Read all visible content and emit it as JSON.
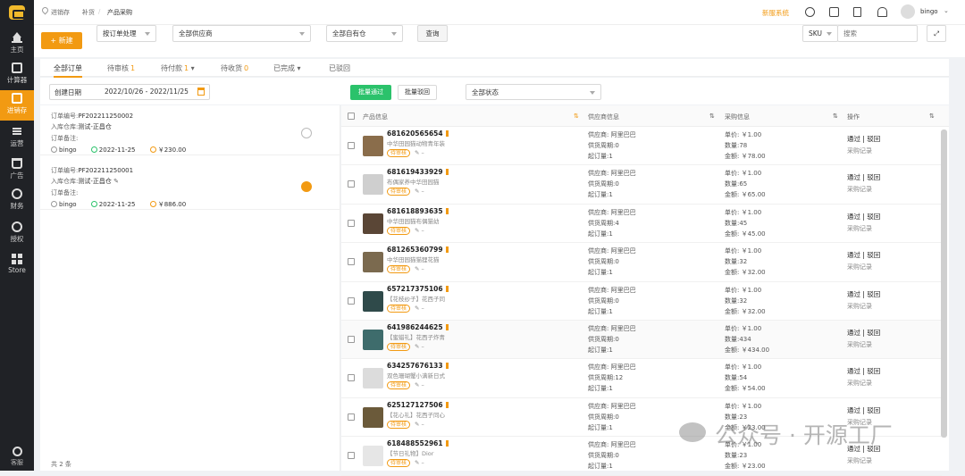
{
  "sidebar": {
    "items": [
      {
        "label": "主页",
        "icon": "home-icon"
      },
      {
        "label": "计算器",
        "icon": "calculator-icon"
      },
      {
        "label": "进销存",
        "icon": "inventory-icon"
      },
      {
        "label": "运营",
        "icon": "operations-icon"
      },
      {
        "label": "广告",
        "icon": "ads-icon"
      },
      {
        "label": "财务",
        "icon": "finance-icon"
      },
      {
        "label": "授权",
        "icon": "auth-icon"
      },
      {
        "label": "Store",
        "icon": "store-icon"
      }
    ],
    "help": "客服",
    "active_index": 2
  },
  "breadcrumb": [
    "进销存",
    "补货",
    "产品采购"
  ],
  "topbar": {
    "notice": "新服系统",
    "username": "bingo"
  },
  "toolbar": {
    "new_label": "+ 新建",
    "by_order": "按订单处理",
    "supplier": "全部供应商",
    "warehouse": "全部自有仓",
    "query": "查询",
    "sku_select": "SKU",
    "search_placeholder": "搜索"
  },
  "tabs": [
    {
      "label": "全部订单",
      "count": ""
    },
    {
      "label": "待审核",
      "count": "1"
    },
    {
      "label": "待付款",
      "count": "1"
    },
    {
      "label": "待收货",
      "count": "0"
    },
    {
      "label": "已完成",
      "count": ""
    },
    {
      "label": "已驳回",
      "count": ""
    }
  ],
  "filter": {
    "date_type": "创建日期",
    "date_range": "2022/10/26 - 2022/11/25",
    "batch_approve": "批量通过",
    "batch_reject": "批量驳回",
    "status": "全部状态"
  },
  "orders": [
    {
      "order_no_label": "订单编号:",
      "order_no": "PF202211250002",
      "warehouse_label": "入库仓库:",
      "warehouse": "测试-正昌仓",
      "note_label": "订单备注:",
      "user": "bingo",
      "date": "2022-11-25",
      "amount": "￥230.00"
    },
    {
      "order_no_label": "订单编号:",
      "order_no": "PF202211250001",
      "warehouse_label": "入库仓库:",
      "warehouse": "测试-正昌仓",
      "note_label": "订单备注:",
      "user": "bingo",
      "date": "2022-11-25",
      "amount": "￥886.00"
    }
  ],
  "total": "共 2 条",
  "table": {
    "headers": [
      "产品信息",
      "供应商信息",
      "采购信息",
      "操作"
    ],
    "rows": [
      {
        "id": "681620565654",
        "name": "中华田园猫动物青年装",
        "status": "待审核",
        "supplier": "供应商: 阿里巴巴",
        "lead": "供货周期:0",
        "moq": "起订量:1",
        "price": "单价: ￥1.00",
        "qty": "数量:78",
        "amount": "金额: ￥78.00"
      },
      {
        "id": "681619433929",
        "name": "布偶家养中华田园猫",
        "status": "待审核",
        "supplier": "供应商: 阿里巴巴",
        "lead": "供货周期:0",
        "moq": "起订量:1",
        "price": "单价: ￥1.00",
        "qty": "数量:65",
        "amount": "金额: ￥65.00"
      },
      {
        "id": "681618893635",
        "name": "中华田园猫布偶猫幼",
        "status": "待审核",
        "supplier": "供应商: 阿里巴巴",
        "lead": "供货周期:4",
        "moq": "起订量:1",
        "price": "单价: ￥1.00",
        "qty": "数量:45",
        "amount": "金额: ￥45.00"
      },
      {
        "id": "681265360799",
        "name": "中华田园猫猫狸花猫",
        "status": "待审核",
        "supplier": "供应商: 阿里巴巴",
        "lead": "供货周期:0",
        "moq": "起订量:1",
        "price": "单价: ￥1.00",
        "qty": "数量:32",
        "amount": "金额: ￥32.00"
      },
      {
        "id": "657217375106",
        "name": "【花枝纱子】花西子同",
        "status": "待审核",
        "supplier": "供应商: 阿里巴巴",
        "lead": "供货周期:0",
        "moq": "起订量:1",
        "price": "单价: ￥1.00",
        "qty": "数量:32",
        "amount": "金额: ￥32.00"
      },
      {
        "id": "641986244625",
        "name": "【蜜蜡礼】花西子炸青",
        "status": "待审核",
        "supplier": "供应商: 阿里巴巴",
        "lead": "供货周期:0",
        "moq": "起订量:1",
        "price": "单价: ￥1.00",
        "qty": "数量:434",
        "amount": "金额: ￥434.00"
      },
      {
        "id": "634257676133",
        "name": "双色珊瑚蟹小满新日式",
        "status": "待审核",
        "supplier": "供应商: 阿里巴巴",
        "lead": "供货周期:12",
        "moq": "起订量:1",
        "price": "单价: ￥1.00",
        "qty": "数量:54",
        "amount": "金额: ￥54.00"
      },
      {
        "id": "625127127506",
        "name": "【花心礼】花西子同心",
        "status": "待审核",
        "supplier": "供应商: 阿里巴巴",
        "lead": "供货周期:0",
        "moq": "起订量:1",
        "price": "单价: ￥1.00",
        "qty": "数量:23",
        "amount": "金额: ￥23.00"
      },
      {
        "id": "618488552961",
        "name": "【节日礼物】Dior",
        "status": "待审核",
        "supplier": "供应商: 阿里巴巴",
        "lead": "供货周期:0",
        "moq": "起订量:1",
        "price": "单价: ￥1.00",
        "qty": "数量:23",
        "amount": "金额: ￥23.00"
      }
    ],
    "action_pass": "通过",
    "action_sep": " | ",
    "action_reject": "驳回",
    "action_record": "采购记录"
  },
  "watermark": "公众号 · 开源工厂",
  "colors": {
    "accent": "#f29a12",
    "green": "#2bc26b",
    "sidebar_bg": "#202226"
  }
}
